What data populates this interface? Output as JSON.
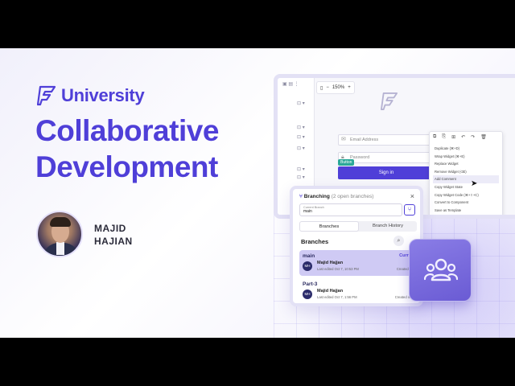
{
  "brand": {
    "name": "University"
  },
  "hero": {
    "title_line1": "Collaborative",
    "title_line2": "Development"
  },
  "author": {
    "first": "MAJID",
    "last": "HAJIAN"
  },
  "editor": {
    "zoom": "150%",
    "email_placeholder": "Email Address",
    "password_placeholder": "Password",
    "button_tag": "Button",
    "signin_label": "Sign in",
    "context_menu": [
      "Duplicate (⌘+D)",
      "Wrap Widget (⌘+E)",
      "Replace Widget",
      "Remove Widget (⌫)",
      "Add Comment",
      "Copy Widget State",
      "Copy Widget Code (⌘+⇧+C)",
      "Convert to Component",
      "Save as Template"
    ]
  },
  "branching": {
    "title": "Branching",
    "count": "(2 open branches)",
    "current_label": "Current Branch",
    "current_value": "main",
    "tabs": [
      "Branches",
      "Branch History"
    ],
    "section_title": "Branches",
    "items": [
      {
        "name": "main",
        "badge": "Current",
        "initials": "MH",
        "user": "Majid Hajjan",
        "edited": "Last edited Oct 7, 10:53 PM",
        "created": "Created on O"
      },
      {
        "name": "Part-3",
        "badge": "",
        "initials": "MH",
        "user": "Majid Hajjan",
        "edited": "Last edited Oct 7, 1:56 PM",
        "created": "Created on Oc"
      }
    ]
  },
  "colors": {
    "accent": "#4f3fd8",
    "tile": "#7b6de0",
    "teal": "#2aa898"
  }
}
